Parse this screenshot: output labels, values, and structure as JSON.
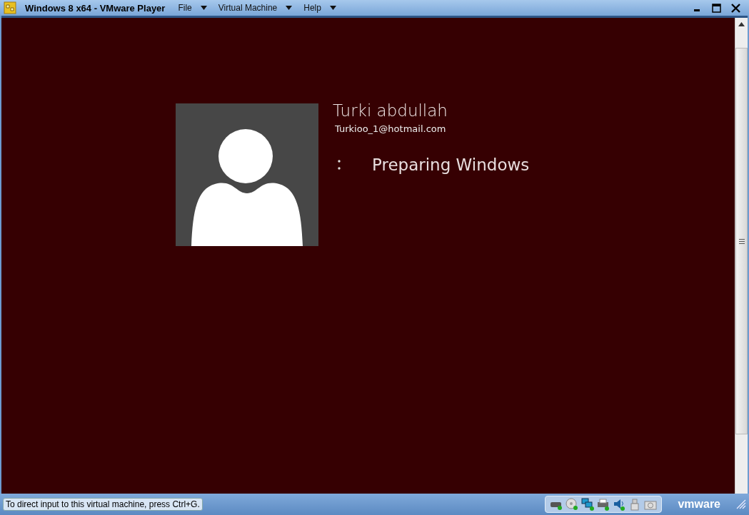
{
  "window": {
    "title": "Windows 8 x64 - VMware Player"
  },
  "menu": [
    {
      "label": "File"
    },
    {
      "label": "Virtual Machine"
    },
    {
      "label": "Help"
    }
  ],
  "guest_screen": {
    "user_name": "Turki abdullah",
    "email": "Turkioo_1@hotmail.com",
    "status": "Preparing Windows"
  },
  "status_bar": {
    "hint": "To direct input to this virtual machine, press Ctrl+G.",
    "devices": [
      {
        "kind": "disk"
      },
      {
        "kind": "cd"
      },
      {
        "kind": "network"
      },
      {
        "kind": "printer"
      },
      {
        "kind": "sound"
      },
      {
        "kind": "usb"
      },
      {
        "kind": "camera"
      }
    ],
    "brand": "vmware"
  }
}
